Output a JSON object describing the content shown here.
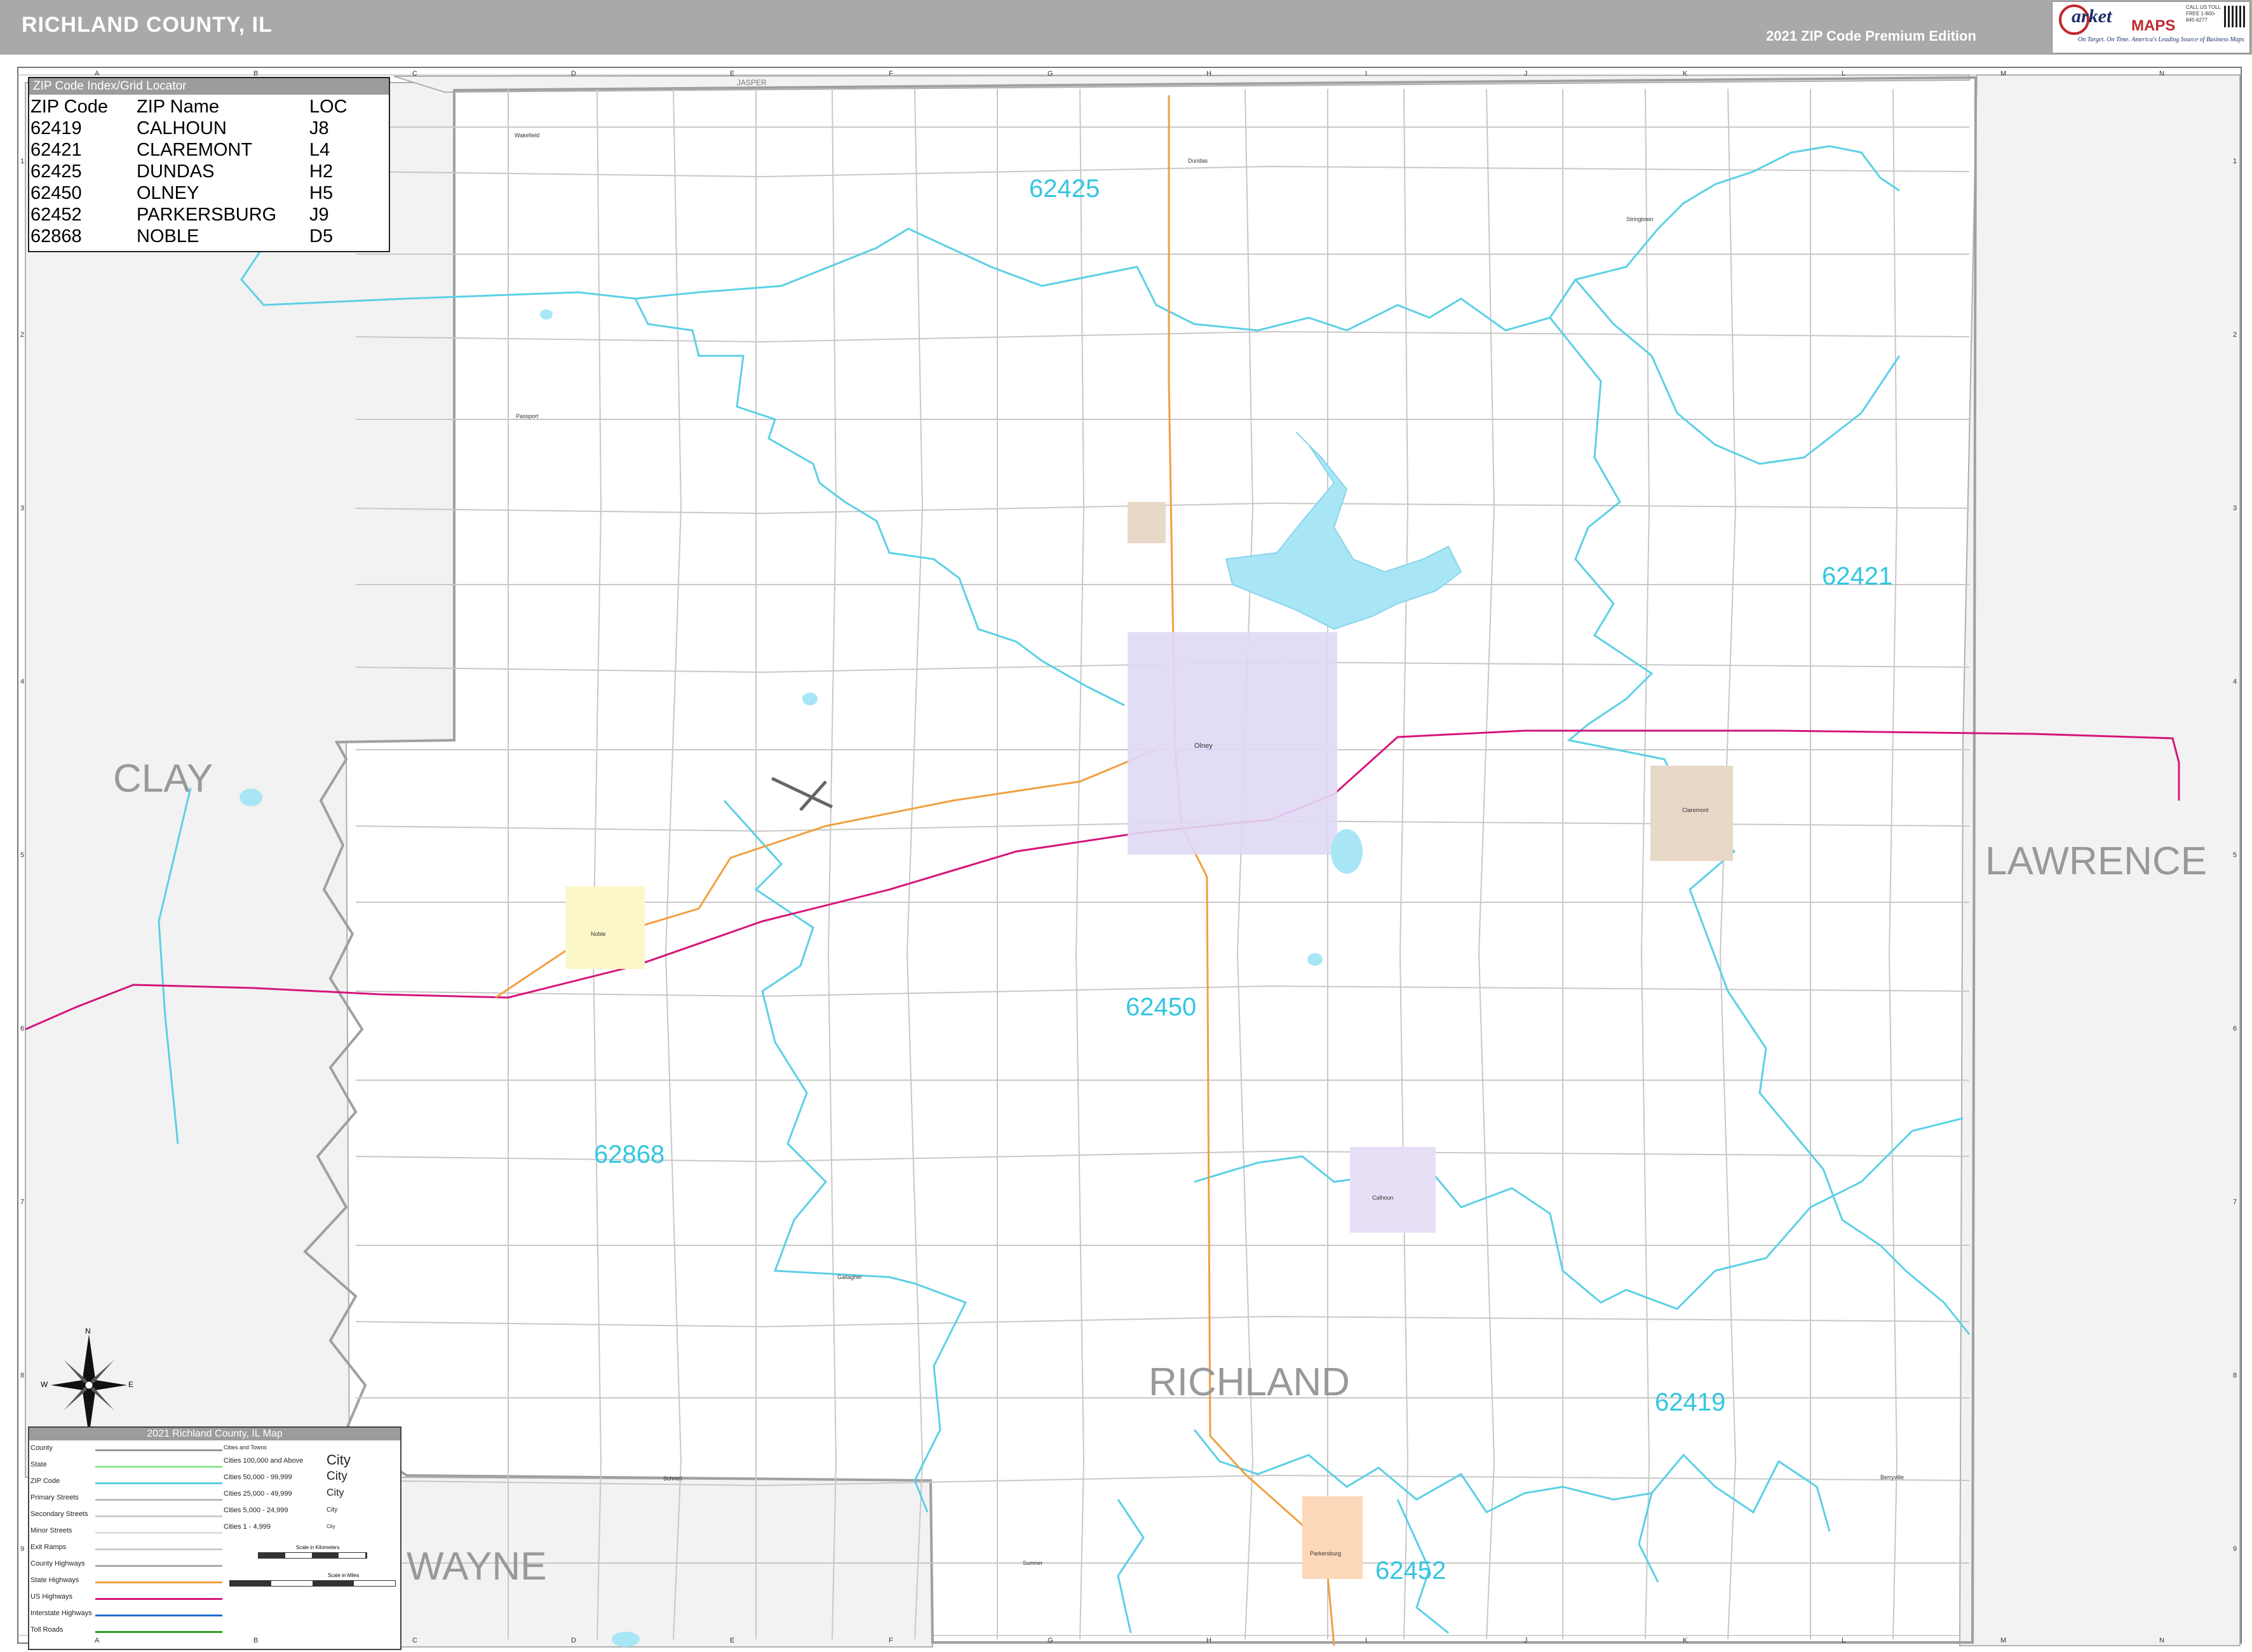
{
  "header": {
    "title": "RICHLAND COUNTY, IL",
    "edition": "2021 ZIP Code Premium Edition",
    "logo": {
      "brand_script": "arket",
      "brand_maps": "MAPS",
      "tagline": "On Target. On Time. America's Leading Source of Business Maps",
      "phone": "CALL US TOLL FREE 1-800-845-6277"
    }
  },
  "grid": {
    "columns": [
      "A",
      "B",
      "C",
      "D",
      "E",
      "F",
      "G",
      "H",
      "I",
      "J",
      "K",
      "L",
      "M",
      "N"
    ],
    "rows": [
      "1",
      "2",
      "3",
      "4",
      "5",
      "6",
      "7",
      "8",
      "9"
    ]
  },
  "zip_index": {
    "caption": "ZIP Code Index/Grid Locator",
    "headers": [
      "ZIP Code",
      "ZIP Name",
      "LOC"
    ],
    "rows": [
      [
        "62419",
        "CALHOUN",
        "J8"
      ],
      [
        "62421",
        "CLAREMONT",
        "L4"
      ],
      [
        "62425",
        "DUNDAS",
        "H2"
      ],
      [
        "62450",
        "OLNEY",
        "H5"
      ],
      [
        "62452",
        "PARKERSBURG",
        "J9"
      ],
      [
        "62868",
        "NOBLE",
        "D5"
      ]
    ]
  },
  "counties": {
    "clay": "CLAY",
    "lawrence": "LAWRENCE",
    "wayne": "WAYNE",
    "richland": "RICHLAND",
    "jasper": "JASPER"
  },
  "zip_labels": {
    "z62425": "62425",
    "z62421": "62421",
    "z62450": "62450",
    "z62868": "62868",
    "z62419": "62419",
    "z62452": "62452"
  },
  "towns": {
    "wakefield": "Wakefield",
    "dundas": "Dundas",
    "stringtown": "Stringtown",
    "passport": "Passport",
    "olney": "Olney",
    "noble": "Noble",
    "claremont": "Claremont",
    "calhoun": "Calhoun",
    "parkersburg": "Parkersburg",
    "schnell": "Schnell",
    "sumner": "Sumner",
    "berryville": "Berryville",
    "stringtown_s": "Stringtown",
    "gallagher": "Gallagher"
  },
  "legend": {
    "caption": "2021 Richland County, IL Map",
    "line_items": [
      "County",
      "State",
      "ZIP Code",
      "Primary Streets",
      "Secondary Streets",
      "Minor Streets",
      "Exit Ramps",
      "County Highways",
      "State Highways",
      "US Highways",
      "Interstate Highways",
      "Toll Roads"
    ],
    "city_header": "Cities and Towns",
    "city_items": [
      "Cities 100,000 and Above",
      "Cities 50,000 - 99,999",
      "Cities 25,000 - 49,999",
      "Cities 5,000 - 24,999",
      "Cities 1 - 4,999"
    ],
    "city_samples": [
      "City",
      "City",
      "City",
      "City",
      "City"
    ],
    "scale_km": "Scale in Kilometers",
    "scale_mi": "Scale in Miles"
  },
  "compass": {
    "n": "N",
    "s": "S",
    "e": "E",
    "w": "W"
  },
  "colors": {
    "zip_boundary": "#5cd0e6",
    "us_highway": "#d6157a",
    "state_highway": "#f0a040",
    "county_bg": "#f2f2f2",
    "olney": "#e0d8f5",
    "noble": "#fbf7c8",
    "claremont": "#e8d8c8",
    "parkersburg": "#fcd7b8",
    "water": "#a8e6f6"
  }
}
